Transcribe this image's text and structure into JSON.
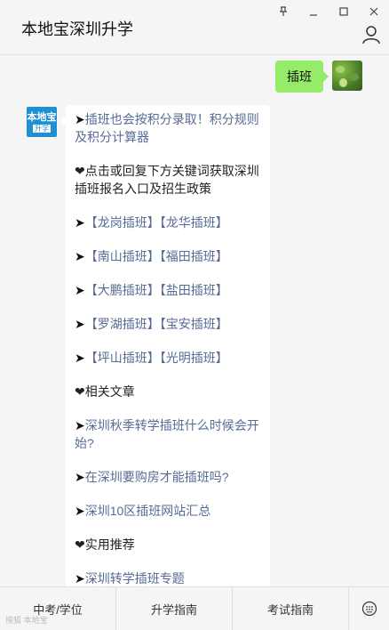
{
  "window": {
    "title": "本地宝深圳升学",
    "controls": [
      "pin-icon",
      "minimize-icon",
      "maximize-icon",
      "close-icon"
    ]
  },
  "outgoing_message": {
    "text": "插班"
  },
  "bot_avatar": {
    "line1": "本地宝",
    "line2": "升学"
  },
  "incoming_message": {
    "paragraphs": [
      {
        "arrow": "➤",
        "text": "插班也会按积分录取！积分规则及积分计算器",
        "type": "link"
      },
      {
        "arrow": "",
        "text": "❤点击或回复下方关键词获取深圳插班报名入口及招生政策",
        "type": "text"
      },
      {
        "arrow": "➤",
        "items": [
          "【龙岗插班】",
          "【龙华插班】"
        ],
        "type": "links"
      },
      {
        "arrow": "➤",
        "items": [
          "【南山插班】",
          "【福田插班】"
        ],
        "type": "links"
      },
      {
        "arrow": "➤",
        "items": [
          "【大鹏插班】",
          "【盐田插班】"
        ],
        "type": "links"
      },
      {
        "arrow": "➤",
        "items": [
          "【罗湖插班】",
          "【宝安插班】"
        ],
        "type": "links"
      },
      {
        "arrow": "➤",
        "items": [
          "【坪山插班】",
          "【光明插班】"
        ],
        "type": "links"
      },
      {
        "arrow": "",
        "text": "❤相关文章",
        "type": "text"
      },
      {
        "arrow": "➤",
        "text": "深圳秋季转学插班什么时候会开始?",
        "type": "link"
      },
      {
        "arrow": "➤",
        "text": "在深圳要购房才能插班吗?",
        "type": "link"
      },
      {
        "arrow": "➤",
        "text": "深圳10区插班网站汇总",
        "type": "link"
      },
      {
        "arrow": "",
        "text": "❤实用推荐",
        "type": "text"
      },
      {
        "arrow": "➤",
        "text": "深圳转学插班专题",
        "type": "link"
      }
    ]
  },
  "bottom_menu": {
    "items": [
      "中考/学位",
      "升学指南",
      "考试指南"
    ]
  },
  "watermark": "搜狐 本地宝"
}
